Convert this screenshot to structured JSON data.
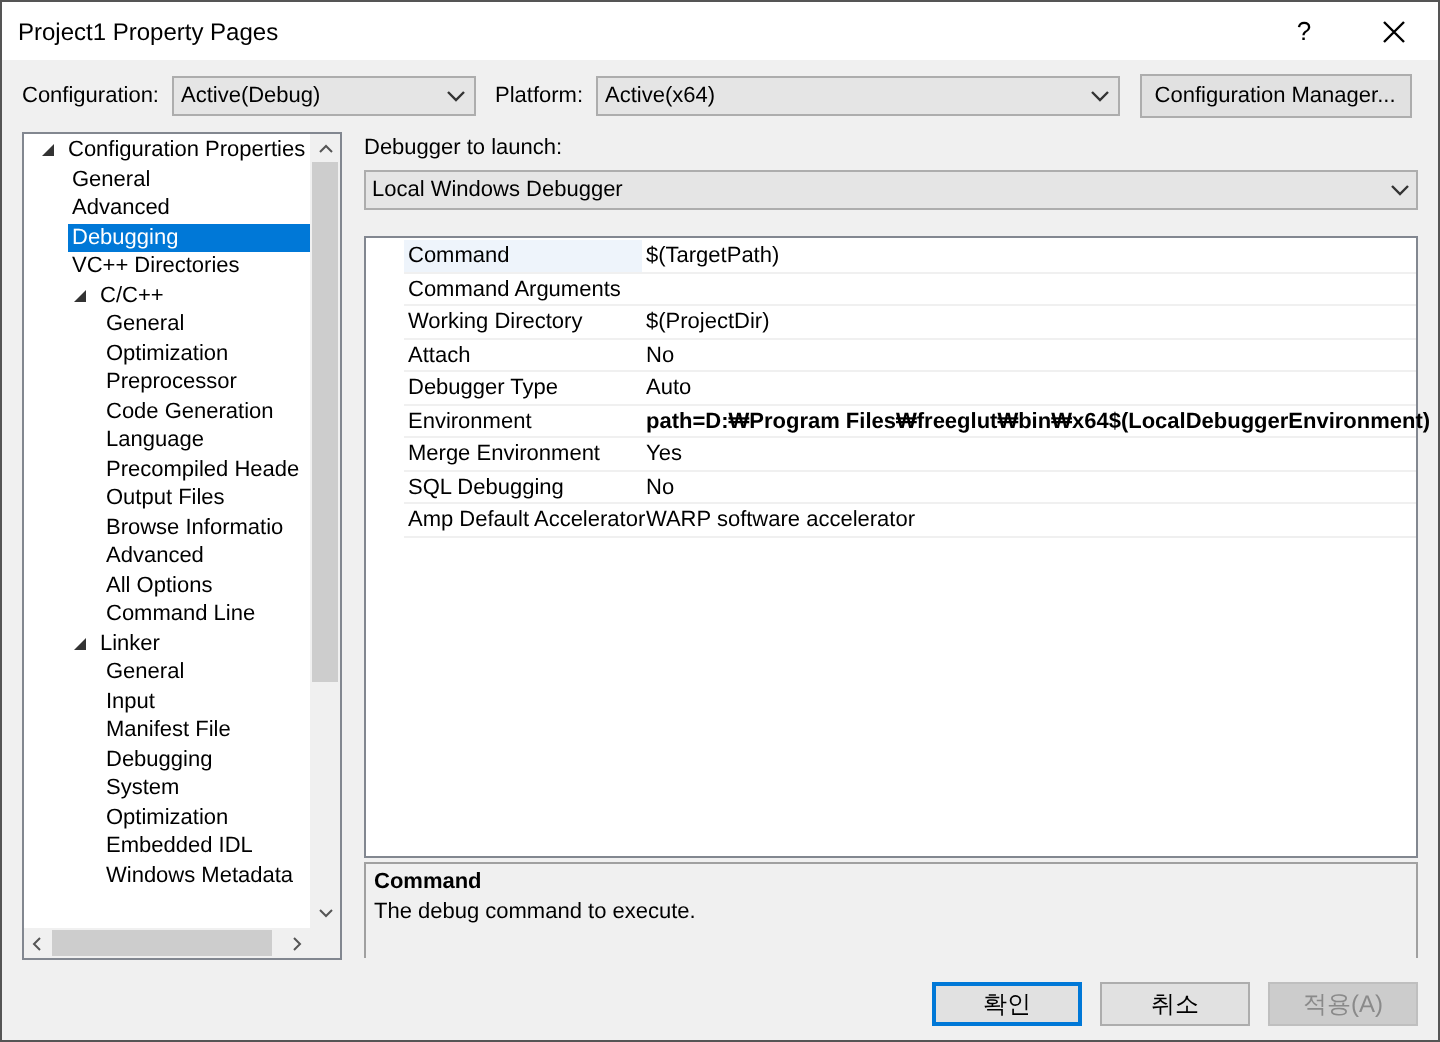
{
  "window": {
    "title": "Project1 Property Pages",
    "help_button": "?"
  },
  "configuration": {
    "label": "Configuration:",
    "value": "Active(Debug)"
  },
  "platform": {
    "label": "Platform:",
    "value": "Active(x64)"
  },
  "configuration_manager_button": "Configuration Manager...",
  "tree": [
    {
      "label": "Configuration Properties",
      "selected": false,
      "expanded": true,
      "children": [
        {
          "label": "General",
          "selected": false
        },
        {
          "label": "Advanced",
          "selected": false
        },
        {
          "label": "Debugging",
          "selected": true
        },
        {
          "label": "VC++ Directories",
          "selected": false
        },
        {
          "label": "C/C++",
          "selected": false,
          "expanded": true,
          "children": [
            {
              "label": "General",
              "selected": false
            },
            {
              "label": "Optimization",
              "selected": false
            },
            {
              "label": "Preprocessor",
              "selected": false
            },
            {
              "label": "Code Generation",
              "selected": false
            },
            {
              "label": "Language",
              "selected": false
            },
            {
              "label": "Precompiled Heade",
              "selected": false
            },
            {
              "label": "Output Files",
              "selected": false
            },
            {
              "label": "Browse Informatio",
              "selected": false
            },
            {
              "label": "Advanced",
              "selected": false
            },
            {
              "label": "All Options",
              "selected": false
            },
            {
              "label": "Command Line",
              "selected": false
            }
          ]
        },
        {
          "label": "Linker",
          "selected": false,
          "expanded": true,
          "children": [
            {
              "label": "General",
              "selected": false
            },
            {
              "label": "Input",
              "selected": false
            },
            {
              "label": "Manifest File",
              "selected": false
            },
            {
              "label": "Debugging",
              "selected": false
            },
            {
              "label": "System",
              "selected": false
            },
            {
              "label": "Optimization",
              "selected": false
            },
            {
              "label": "Embedded IDL",
              "selected": false
            },
            {
              "label": "Windows Metadata",
              "selected": false
            }
          ]
        }
      ]
    }
  ],
  "debugger": {
    "label": "Debugger to launch:",
    "value": "Local Windows Debugger"
  },
  "properties": [
    {
      "name": "Command",
      "value": "$(TargetPath)",
      "selected": true
    },
    {
      "name": "Command Arguments",
      "selected": false
    },
    {
      "name": "Working Directory",
      "value": "$(ProjectDir)",
      "selected": false
    },
    {
      "name": "Attach",
      "value": "No",
      "selected": false
    },
    {
      "name": "Debugger Type",
      "value": "Auto",
      "selected": false
    },
    {
      "name": "Environment",
      "value": "path=D:₩Program Files₩freeglut₩bin₩x64$(LocalDebuggerEnvironment)",
      "selected": false,
      "bold": true
    },
    {
      "name": "Merge Environment",
      "value": "Yes",
      "selected": false
    },
    {
      "name": "SQL Debugging",
      "value": "No",
      "selected": false
    },
    {
      "name": "Amp Default Accelerator",
      "value": "WARP software accelerator",
      "selected": false
    }
  ],
  "description": {
    "title": "Command",
    "text": "The debug command to execute."
  },
  "buttons": [
    {
      "label": "확인",
      "default": true,
      "disabled": false
    },
    {
      "label": "취소",
      "default": false,
      "disabled": false
    },
    {
      "label": "적용(A)",
      "default": false,
      "disabled": true
    }
  ]
}
